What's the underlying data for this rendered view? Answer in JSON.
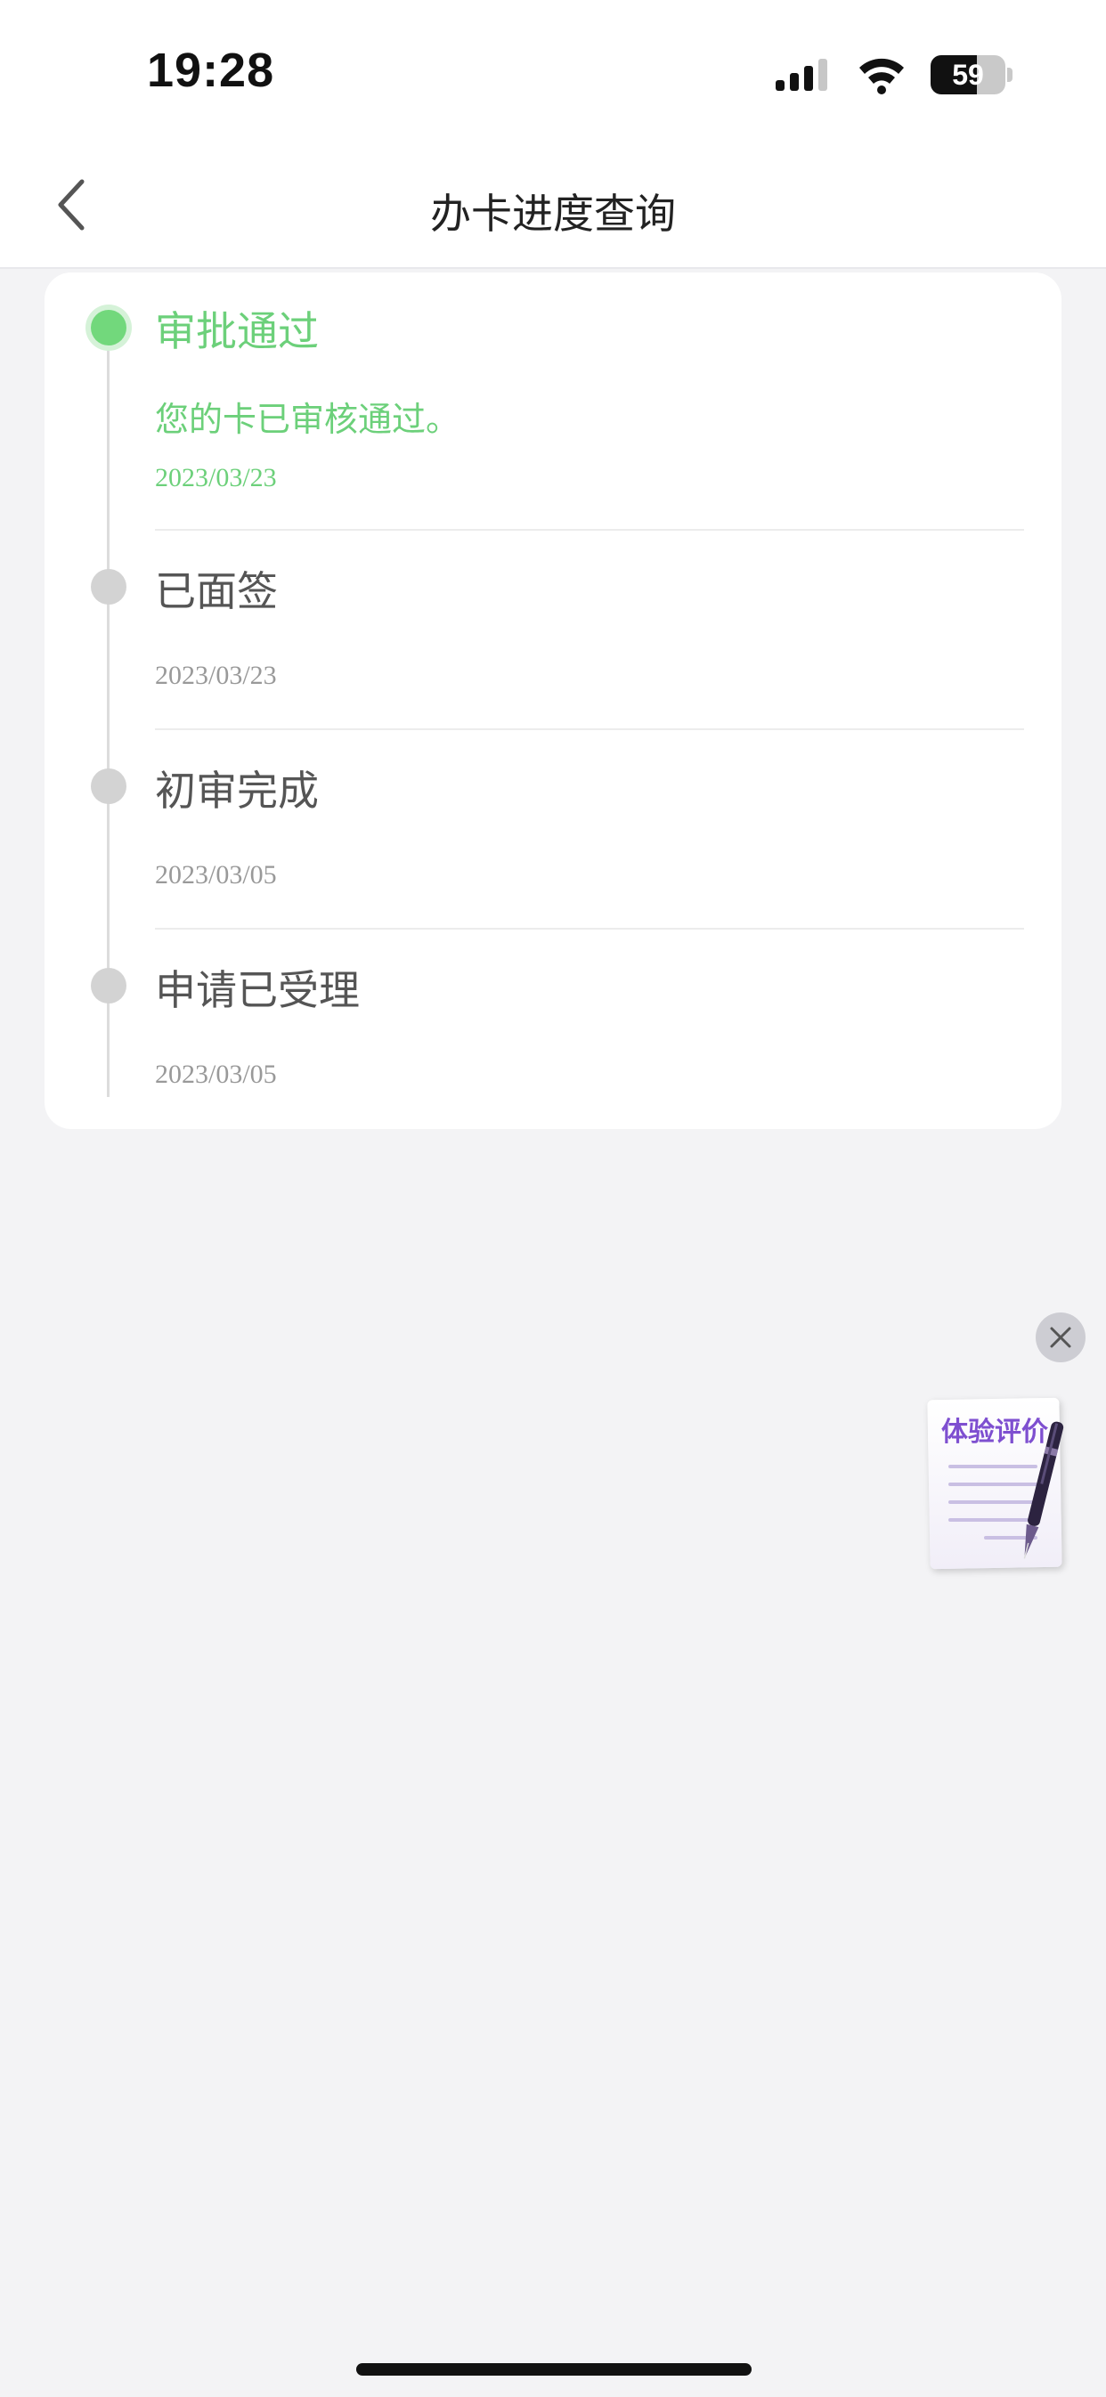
{
  "status_bar": {
    "time": "19:28",
    "battery": "59",
    "icons": [
      "cellular-signal-icon",
      "wifi-icon",
      "battery-icon"
    ]
  },
  "header": {
    "back_icon": "chevron-left-icon",
    "title": "办卡进度查询"
  },
  "timeline": {
    "steps": [
      {
        "title": "审批通过",
        "description": "您的卡已审核通过。",
        "date": "2023/03/23",
        "state": "current"
      },
      {
        "title": "已面签",
        "description": "",
        "date": "2023/03/23",
        "state": "done"
      },
      {
        "title": "初审完成",
        "description": "",
        "date": "2023/03/05",
        "state": "done"
      },
      {
        "title": "申请已受理",
        "description": "",
        "date": "2023/03/05",
        "state": "done"
      }
    ]
  },
  "feedback_widget": {
    "label": "体验评价",
    "close_icon": "close-icon",
    "icon": "pen-and-paper-icon"
  },
  "colors": {
    "accent_green": "#6cd07a",
    "inactive_gray": "#d3d3d3",
    "background": "#f3f3f5",
    "widget_purple": "#7e4fd0"
  }
}
